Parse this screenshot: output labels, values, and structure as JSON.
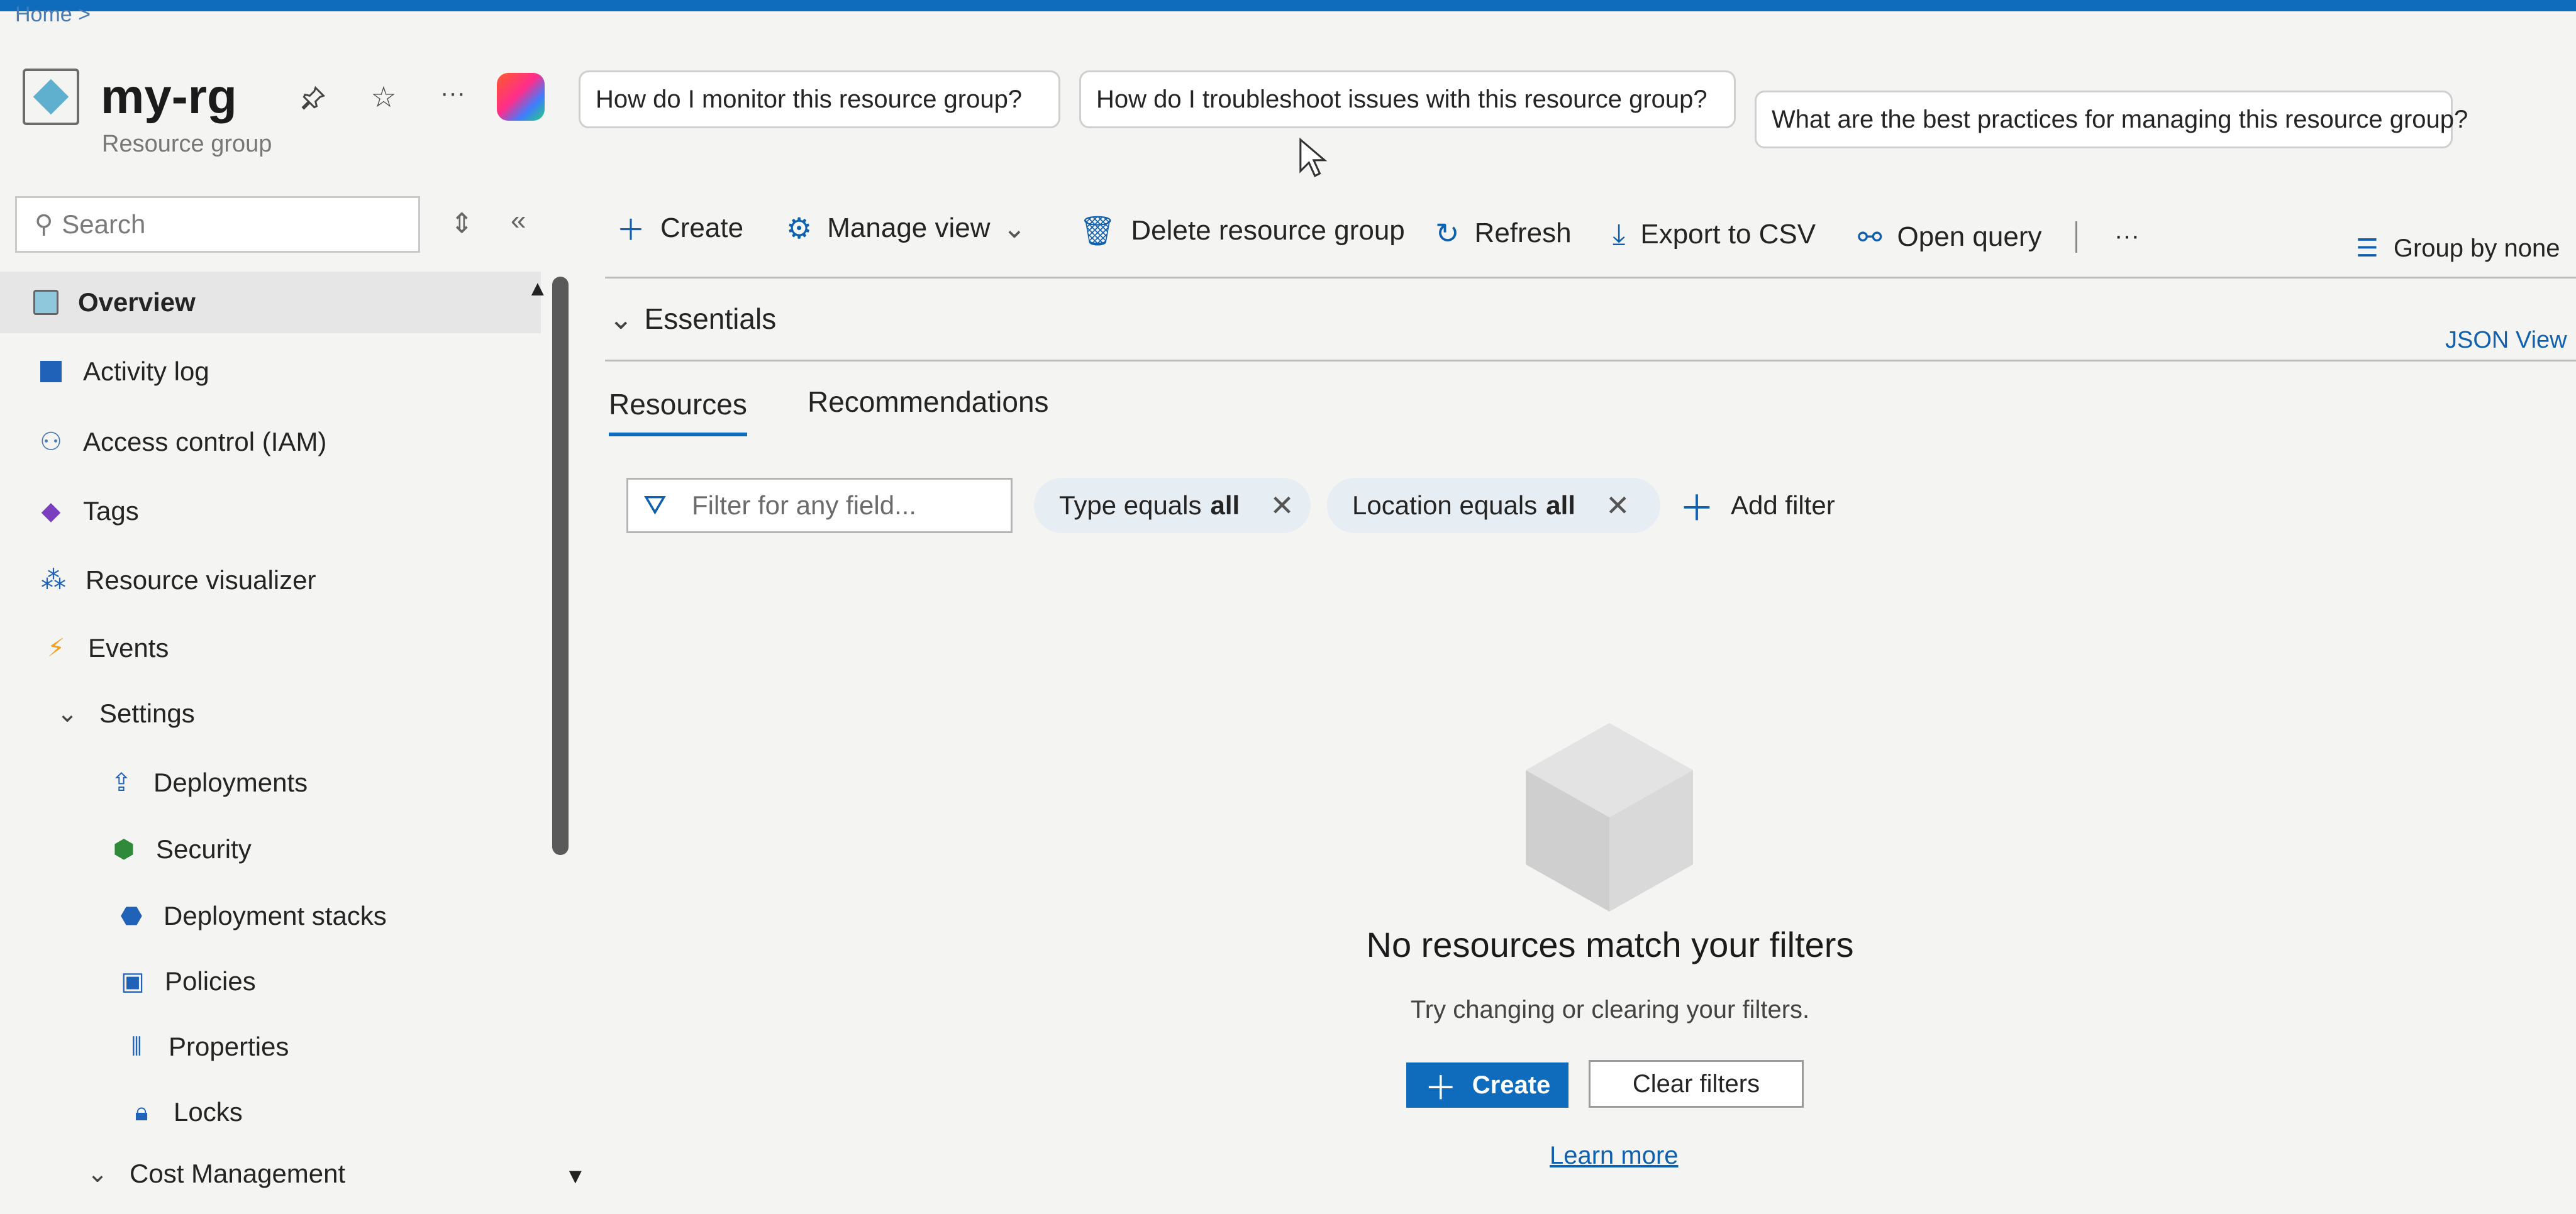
{
  "breadcrumb": {
    "home": "Home"
  },
  "resource": {
    "name": "my-rg",
    "type": "Resource group"
  },
  "copilot_suggestions": [
    "How do I monitor this resource group?",
    "How do I troubleshoot issues with this resource group?",
    "What are the best practices for managing this resource group?"
  ],
  "search": {
    "placeholder": "Search"
  },
  "nav": {
    "overview": "Overview",
    "activity_log": "Activity log",
    "iam": "Access control (IAM)",
    "tags": "Tags",
    "visualizer": "Resource visualizer",
    "events": "Events",
    "settings": "Settings",
    "deployments": "Deployments",
    "security": "Security",
    "deployment_stacks": "Deployment stacks",
    "policies": "Policies",
    "properties": "Properties",
    "locks": "Locks",
    "cost_management": "Cost Management"
  },
  "toolbar": {
    "create": "Create",
    "manage_view": "Manage view",
    "delete": "Delete resource group",
    "refresh": "Refresh",
    "export": "Export to CSV",
    "open_query": "Open query",
    "group_by": "Group by none"
  },
  "essentials": {
    "label": "Essentials",
    "json_view": "JSON View"
  },
  "tabs": {
    "resources": "Resources",
    "recommendations": "Recommendations"
  },
  "filters": {
    "placeholder": "Filter for any field...",
    "type_label": "Type equals",
    "type_value": "all",
    "location_label": "Location equals",
    "location_value": "all",
    "add_filter": "Add filter"
  },
  "empty_state": {
    "title": "No resources match your filters",
    "subtitle": "Try changing or clearing your filters.",
    "create": "Create",
    "clear": "Clear filters",
    "learn_more": "Learn more"
  },
  "colors": {
    "accent": "#0f6cbd",
    "pill_bg": "#e7eef3"
  }
}
